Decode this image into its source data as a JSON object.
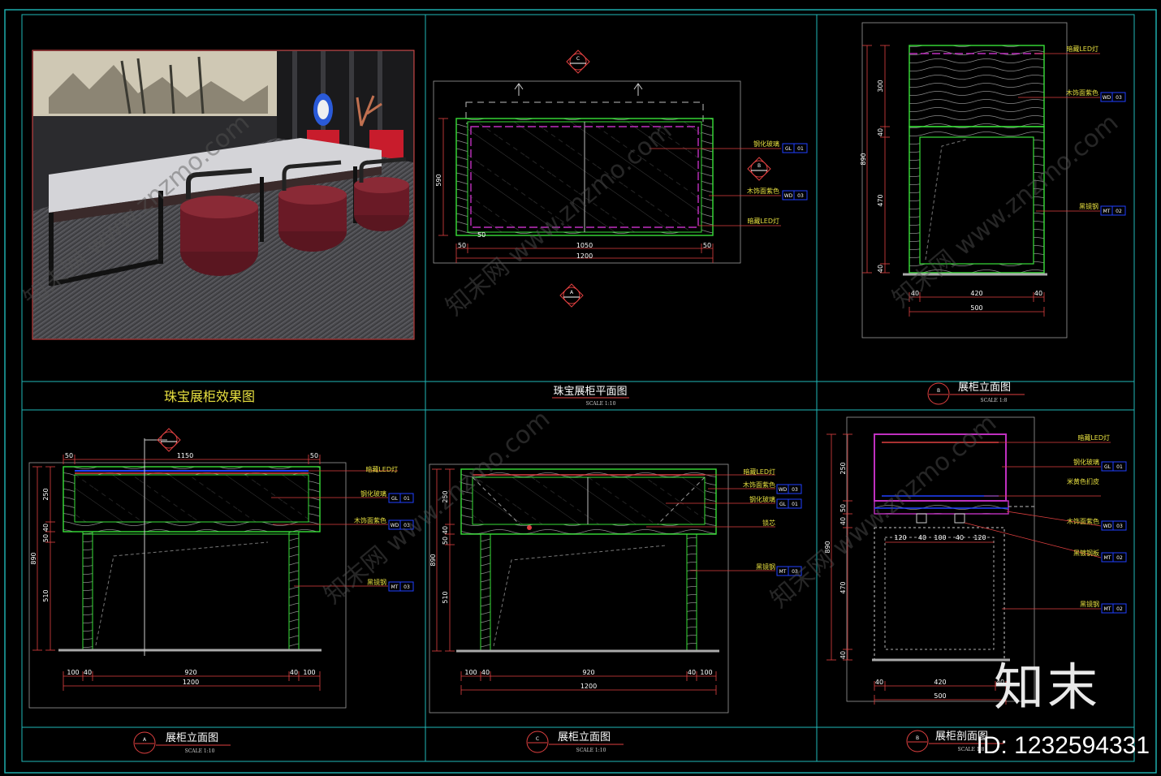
{
  "panels": {
    "render": {
      "title": "珠宝展柜效果图"
    },
    "plan": {
      "title": "珠宝展柜平面图",
      "scale": "SCALE 1:10",
      "sec_top": "C",
      "sec_bottom": "A",
      "sec_right": "B",
      "dims": {
        "w_total": "1200",
        "w_mid": "1050",
        "w_l": "50",
        "w_r": "50",
        "h": "590",
        "s": "50"
      },
      "labels": [
        "钢化玻璃",
        "木饰面紫色",
        "暗藏LED灯"
      ],
      "tags": [
        [
          "GL",
          "01"
        ],
        [
          "WD",
          "03"
        ]
      ]
    },
    "b_elev": {
      "title": "展柜立面图",
      "scale": "SCALE 1:8",
      "mark": "B",
      "dims": {
        "h_total": "890",
        "h1": "300",
        "h2": "40",
        "h3": "470",
        "h4": "40",
        "w_total": "500",
        "w_mid": "420",
        "w_l": "40",
        "w_r": "40"
      },
      "labels": [
        "暗藏LED灯",
        "木饰面紫色",
        "黑镜钢"
      ],
      "tags": [
        [
          "WD",
          "03"
        ],
        [
          "MT",
          "02"
        ]
      ]
    },
    "a_elev": {
      "title": "展柜立面图",
      "scale": "SCALE 1:10",
      "mark": "A",
      "dims": {
        "top_total": "1150",
        "top_l": "50",
        "top_r": "50",
        "h_total": "890",
        "h1": "250",
        "h2": "40",
        "h3": "50",
        "h4": "510",
        "w_total": "1200",
        "w_mid": "920",
        "w_a": "100",
        "w_b": "40",
        "w_c": "40",
        "w_d": "100"
      },
      "labels": [
        "暗藏LED灯",
        "钢化玻璃",
        "木饰面紫色",
        "黑镜钢"
      ],
      "tags": [
        [
          "GL",
          "01"
        ],
        [
          "WD",
          "03"
        ],
        [
          "MT",
          "03"
        ]
      ]
    },
    "c_elev": {
      "title": "展柜立面图",
      "scale": "SCALE 1:10",
      "mark": "C",
      "dims": {
        "h_total": "890",
        "h1": "250",
        "h2": "40",
        "h3": "50",
        "h4": "510",
        "w_total": "1200",
        "w_mid": "920",
        "w_a": "100",
        "w_b": "40",
        "w_c": "40",
        "w_d": "100"
      },
      "labels": [
        "暗藏LED灯",
        "木饰面紫色",
        "钢化玻璃",
        "锁芯",
        "黑镜钢"
      ],
      "tags": [
        [
          "WD",
          "03"
        ],
        [
          "GL",
          "01"
        ],
        [
          "MT",
          "03"
        ]
      ]
    },
    "section": {
      "title": "展柜剖面图",
      "scale": "SCALE 1:8",
      "mark": "B",
      "dims": {
        "h_total": "890",
        "h1": "250",
        "h2": "50",
        "h3": "40",
        "h4": "470",
        "h5": "40",
        "w_total": "500",
        "w_mid": "420",
        "w_l": "40",
        "w_r": "40",
        "d1": "120",
        "d2": "40",
        "d3": "100",
        "d4": "40",
        "d5": "120"
      },
      "labels": [
        "暗藏LED灯",
        "钢化玻璃",
        "米黄色扪皮",
        "木饰面紫色",
        "黑镀钢板",
        "黑镜钢"
      ],
      "tags": [
        [
          "GL",
          "01"
        ],
        [
          "WD",
          "03"
        ],
        [
          "MT",
          "02"
        ],
        [
          "MT",
          "02"
        ]
      ]
    }
  },
  "watermark": {
    "text": "知末网 www.znzmo.com"
  },
  "brand": {
    "logo": "知末",
    "id": "ID: 1232594331"
  },
  "colors": {
    "frame": "#20b8b8",
    "outline": "#38e038",
    "dim": "#e04040",
    "text": "#e8e040",
    "glass": "#c030c0",
    "tag": "#2040ff"
  }
}
